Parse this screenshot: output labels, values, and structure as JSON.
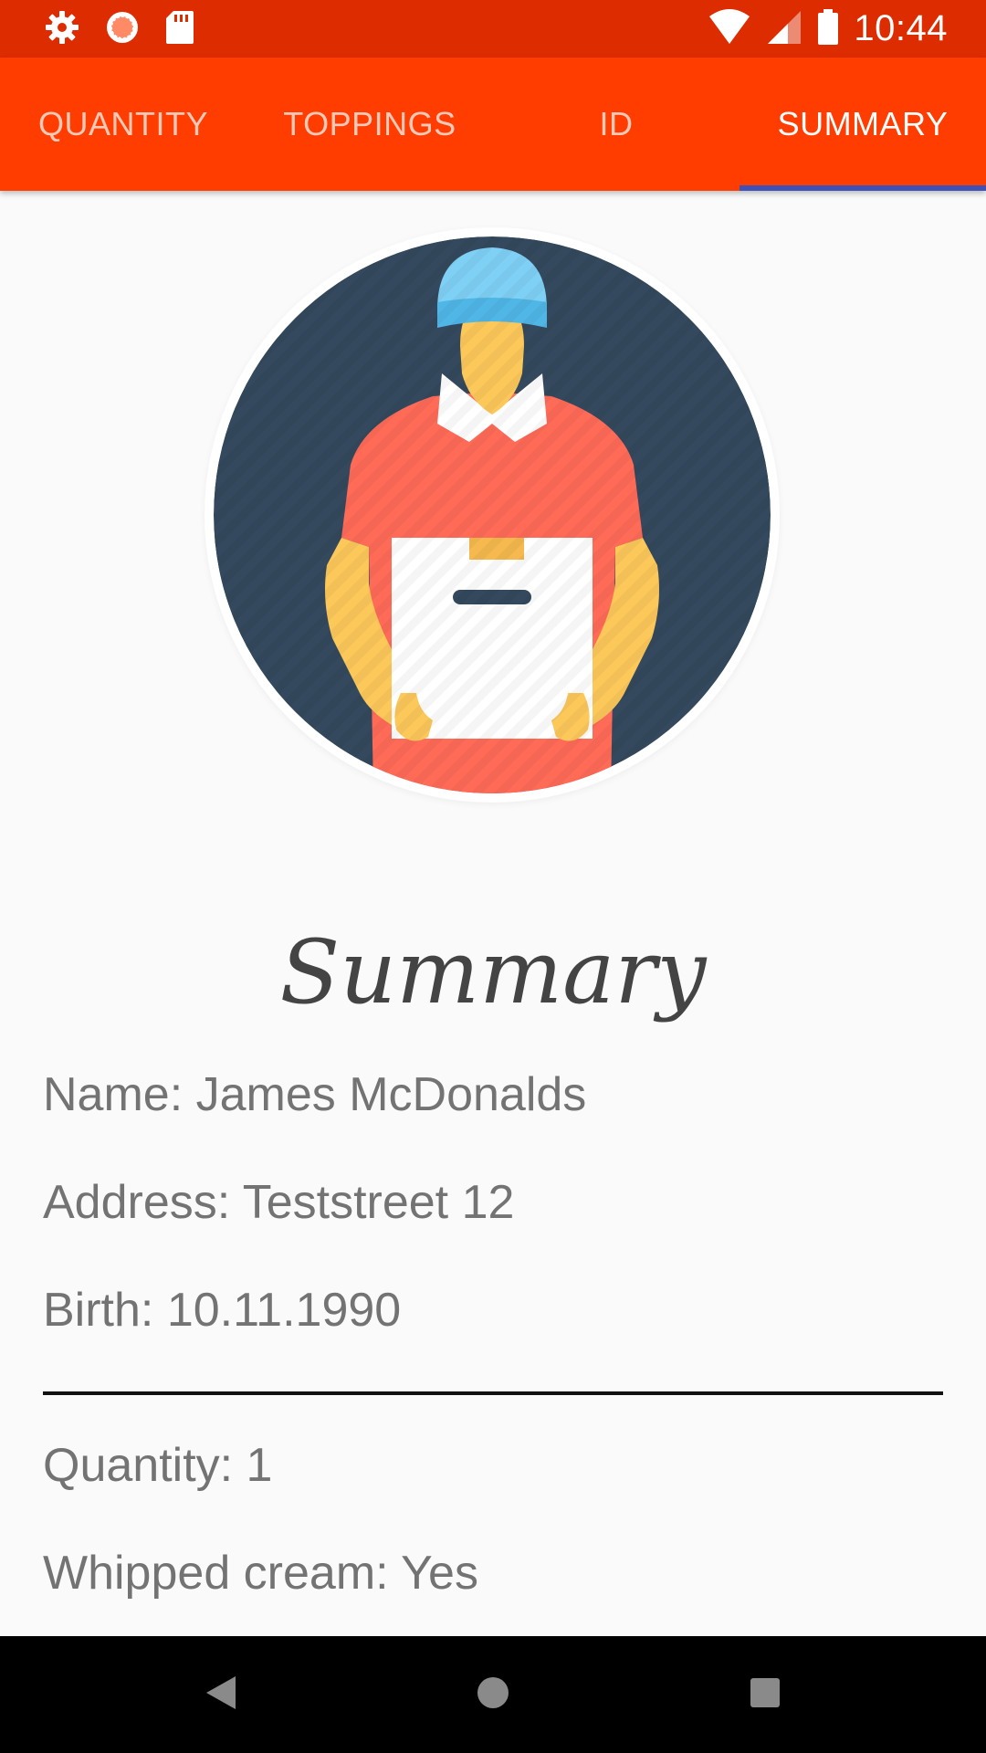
{
  "status_bar": {
    "time": "10:44",
    "icons": [
      "gear-icon",
      "clock-sync-icon",
      "sd-card-icon",
      "wifi-icon",
      "signal-icon",
      "battery-icon"
    ]
  },
  "tabs": [
    {
      "label": "QUANTITY",
      "active": false
    },
    {
      "label": "TOPPINGS",
      "active": false
    },
    {
      "label": "ID",
      "active": false
    },
    {
      "label": "SUMMARY",
      "active": true
    }
  ],
  "colors": {
    "status_bar": "#dd2c00",
    "tab_bar": "#ff3d00",
    "indicator": "#3f51b5",
    "avatar_bg": "#34495e",
    "shirt": "#ff6b57",
    "skin": "#fcc85a",
    "cap": "#5ec4f0"
  },
  "avatar": {
    "icon": "delivery-man-icon"
  },
  "summary": {
    "title": "Summary",
    "name": "Name: James McDonalds",
    "address": "Address: Teststreet 12",
    "birth": "Birth: 10.11.1990",
    "quantity": "Quantity: 1",
    "whipped_cream": "Whipped cream: Yes"
  },
  "nav": {
    "icons": [
      "back-icon",
      "home-icon",
      "recents-icon"
    ]
  }
}
